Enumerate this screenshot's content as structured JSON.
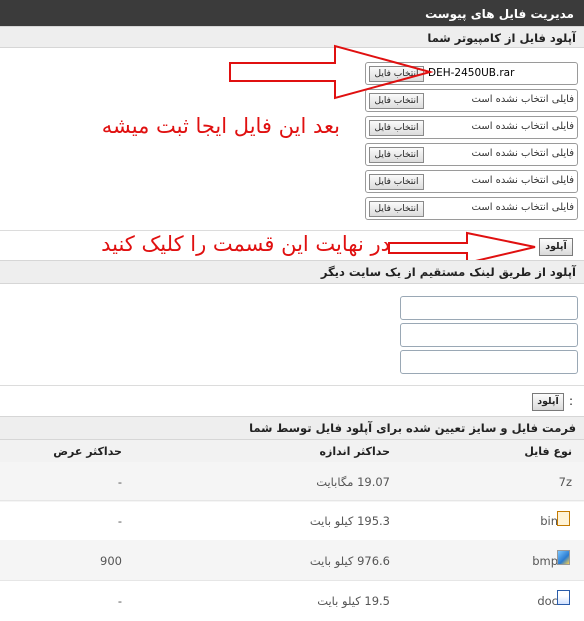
{
  "title": "مدیریت فایل های پیوست",
  "computer_upload": {
    "heading": "آپلود فایل از کامپیوتر شما",
    "browse_label": "انتخاب فایل",
    "no_file_text": "فایلی انتخاب نشده است",
    "selected_file": "DEH-2450UB.rar"
  },
  "annotation_1": "بعد این فایل ایجا ثبت میشه",
  "annotation_2": "در نهایت این قسمت را کلیک کنید",
  "upload_button_label": "آپلود",
  "link_upload": {
    "heading": "آپلود از طریق لینک مستقیم از یک سایت دیگر"
  },
  "link_upload_button_label": "آپلود",
  "link_colon": ":",
  "formats": {
    "heading": "فرمت فایل و سایز تعیین شده برای آپلود فایل توسط شما",
    "columns": {
      "type": "نوع فایل",
      "max_size": "حداکثر اندازه",
      "max_width": "حداکثر عرض"
    },
    "rows": [
      {
        "ext": "7z",
        "size": "19.07 مگابایت",
        "width": "-",
        "icon": "none"
      },
      {
        "ext": "bin",
        "size": "195.3 کیلو بایت",
        "width": "-",
        "icon": "bin-file-icon"
      },
      {
        "ext": "bmp",
        "size": "976.6 کیلو بایت",
        "width": "900",
        "icon": "bmp-file-icon"
      },
      {
        "ext": "doc",
        "size": "19.5 کیلو بایت",
        "width": "-",
        "icon": "doc-file-icon"
      }
    ]
  },
  "colors": {
    "annotation": "#e01010",
    "titlebar": "#3b3b3b"
  }
}
